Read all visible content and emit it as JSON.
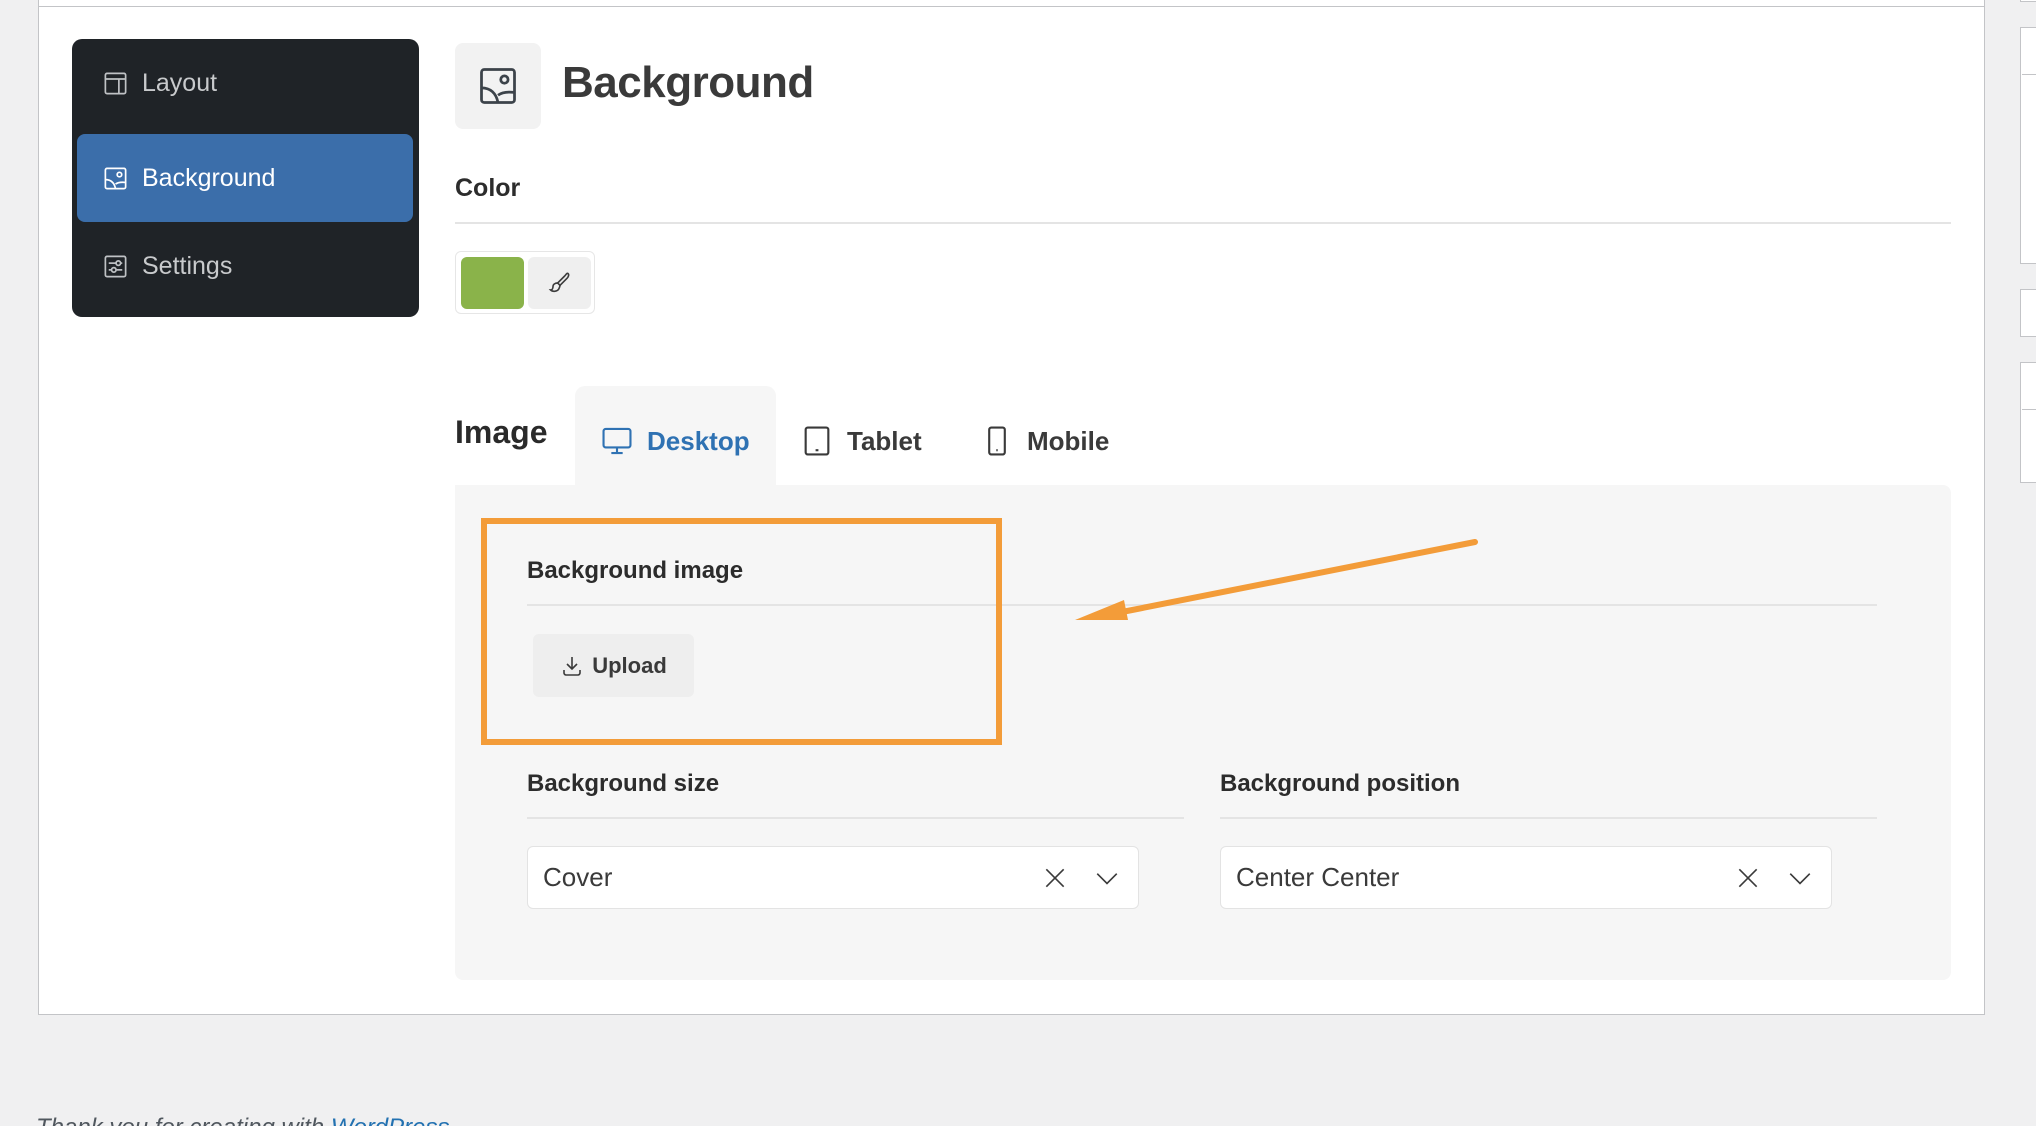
{
  "sidebar": {
    "items": [
      {
        "label": "Layout",
        "icon": "layout-icon",
        "active": false
      },
      {
        "label": "Background",
        "icon": "image-icon",
        "active": true
      },
      {
        "label": "Settings",
        "icon": "sliders-icon",
        "active": false
      }
    ]
  },
  "header": {
    "icon": "image-icon",
    "title": "Background"
  },
  "color_section": {
    "label": "Color",
    "swatch_color": "#8ab34a",
    "picker_icon": "brush-icon"
  },
  "image_section": {
    "label": "Image",
    "tabs": [
      {
        "label": "Desktop",
        "icon": "desktop-icon",
        "active": true
      },
      {
        "label": "Tablet",
        "icon": "tablet-icon",
        "active": false
      },
      {
        "label": "Mobile",
        "icon": "mobile-icon",
        "active": false
      }
    ],
    "background_image": {
      "label": "Background image",
      "upload_label": "Upload",
      "upload_icon": "download-icon"
    },
    "background_size": {
      "label": "Background size",
      "value": "Cover"
    },
    "background_position": {
      "label": "Background position",
      "value": "Center Center"
    }
  },
  "annotation": {
    "highlight_color": "#f39c39",
    "target": "Background image"
  },
  "footer": {
    "text": "Thank you for creating with ",
    "link": "WordPress"
  },
  "colors": {
    "accent": "#3b6eaa",
    "tab_active": "#2f72b3",
    "sidebar_bg": "#1f2327"
  }
}
